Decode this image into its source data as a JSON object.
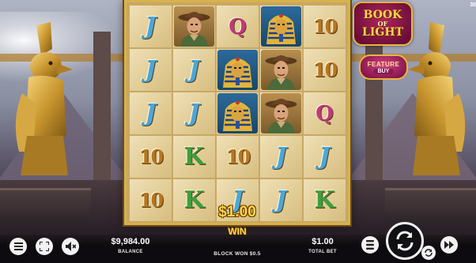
{
  "game": {
    "corner_text": "30",
    "logo": {
      "line1": "BOOK",
      "line2": "OF",
      "line3": "LIGHT"
    },
    "feature_button": {
      "line1": "FEATURE",
      "line2": "BUY"
    }
  },
  "reels": {
    "columns": 5,
    "rows": 5,
    "grid": [
      [
        "J",
        "EXPLORER",
        "Q",
        "PHARAOH",
        "10"
      ],
      [
        "J",
        "J",
        "PHARAOH",
        "EXPLORER",
        "10"
      ],
      [
        "J",
        "J",
        "PHARAOH",
        "EXPLORER",
        "Q"
      ],
      [
        "10",
        "K",
        "10",
        "J",
        "J"
      ],
      [
        "10",
        "K",
        "J",
        "J",
        "K"
      ]
    ]
  },
  "win": {
    "amount": "$1.00",
    "label": "WIN"
  },
  "bottom_bar": {
    "balance_value": "$9,984.00",
    "balance_label": "BALANCE",
    "block_won": "BLOCK WON $0.5",
    "total_bet_value": "$1.00",
    "total_bet_label": "TOTAL BET",
    "icons": {
      "menu": "menu-icon",
      "fullscreen": "fullscreen-icon",
      "sound": "sound-muted-icon",
      "bet_settings": "coin-stack-icon",
      "spin": "spin-icon",
      "autoplay": "autoplay-icon",
      "turbo": "fast-forward-icon"
    }
  },
  "colors": {
    "J": "#4aa7da",
    "Q": "#c0397d",
    "K": "#3e9e3f",
    "10": "#b8761d",
    "gold": "#ffd84a",
    "logo_bg": "#8a1745"
  }
}
